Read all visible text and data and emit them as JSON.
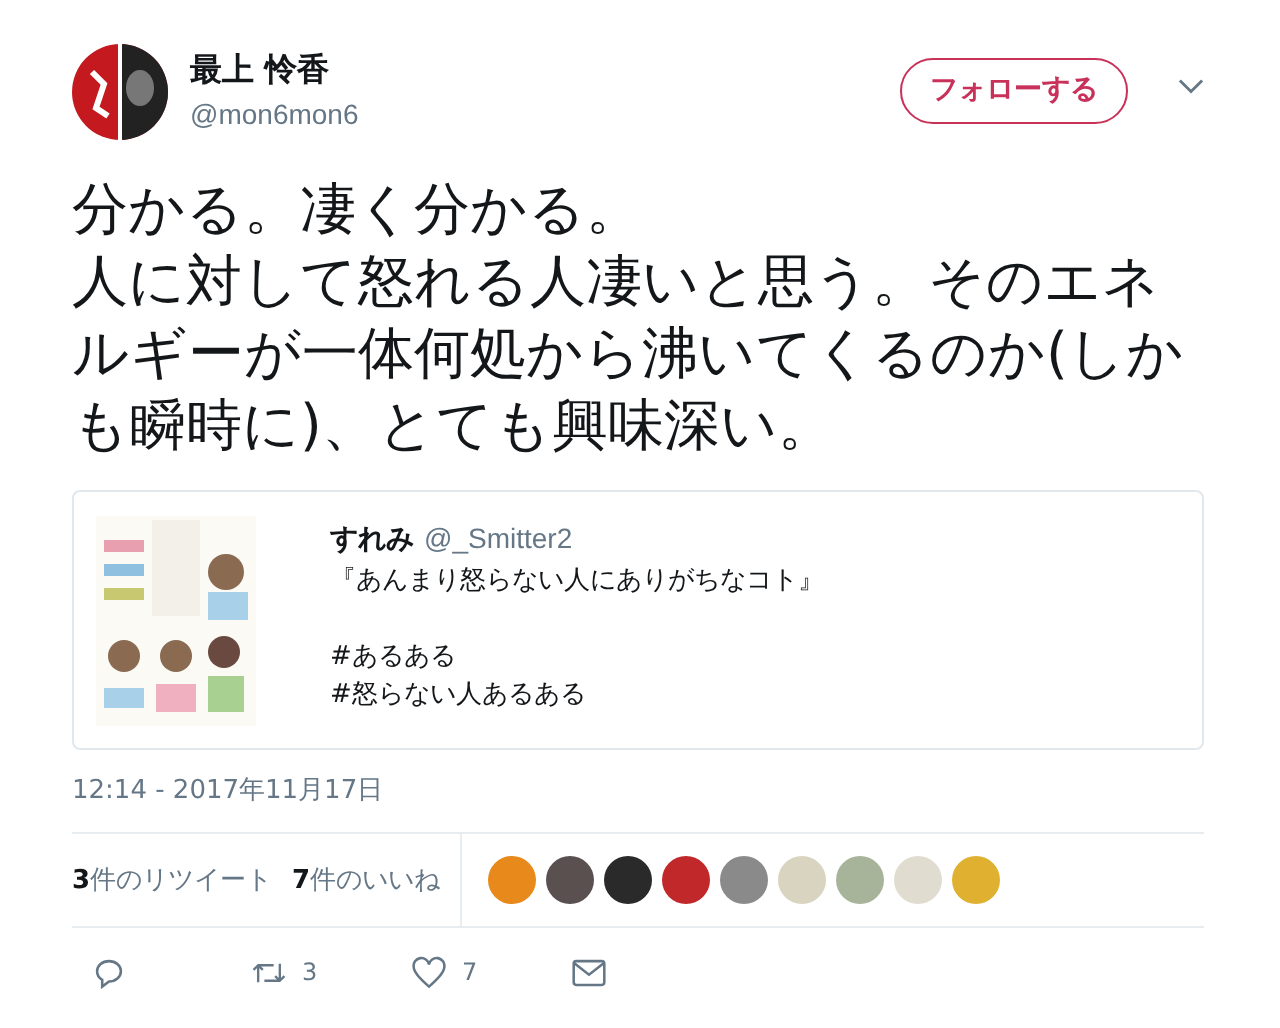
{
  "author": {
    "name": "最上 怜香",
    "handle": "@mon6mon6"
  },
  "follow_button": "フォローする",
  "tweet_text": [
    "分かる。凄く分かる。",
    "人に対して怒れる人凄いと思う。そのエネルギーが一体何処から沸いてくるのか(しかも瞬時に)、とても興味深い。"
  ],
  "quoted_tweet": {
    "name": "すれみ",
    "handle": "@_Smitter2",
    "title": "『あんまり怒らない人にありがちなコト』",
    "hashtags": [
      "#あるある",
      "#怒らない人あるある"
    ]
  },
  "timestamp": "12:14 - 2017年11月17日",
  "stats": [
    {
      "count": "3",
      "label": "件のリツイート"
    },
    {
      "count": "7",
      "label": "件のいいね"
    }
  ],
  "likers": [
    {
      "color": "#e8891c"
    },
    {
      "color": "#5a5050"
    },
    {
      "color": "#2a2a2a"
    },
    {
      "color": "#c0282a"
    },
    {
      "color": "#8a8a8a"
    },
    {
      "color": "#d8d4c0"
    },
    {
      "color": "#a8b49a"
    },
    {
      "color": "#e0ddd0"
    },
    {
      "color": "#e0b030"
    }
  ],
  "actions": [
    {
      "kind": "reply"
    },
    {
      "kind": "retweet",
      "count": "3"
    },
    {
      "kind": "like",
      "count": "7"
    },
    {
      "kind": "message"
    }
  ]
}
